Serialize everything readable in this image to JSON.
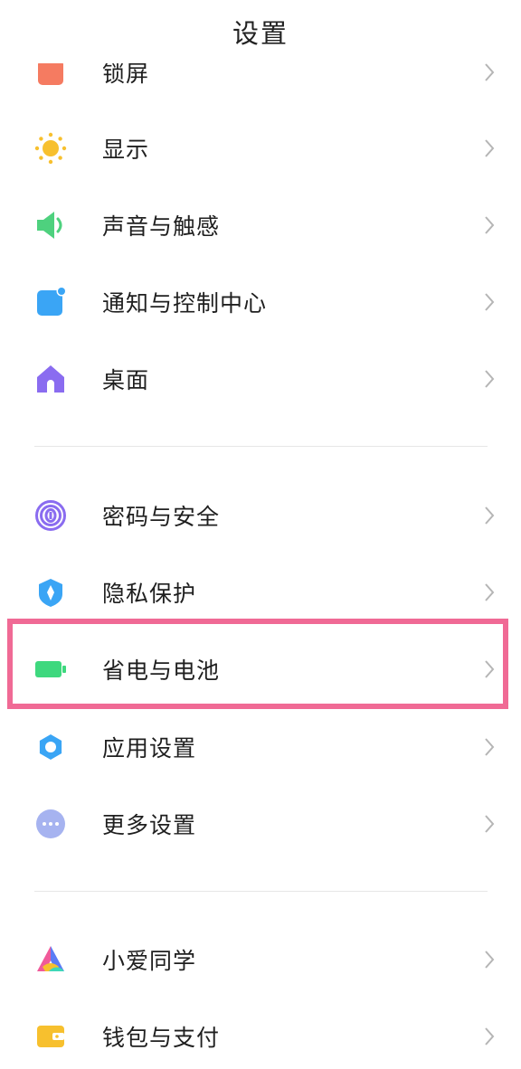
{
  "header": {
    "title": "设置"
  },
  "colors": {
    "highlight": "#f06a95"
  },
  "groups": [
    {
      "items": [
        {
          "label": "锁屏",
          "icon": "lock-screen-icon",
          "color": "#f57b61"
        },
        {
          "label": "显示",
          "icon": "sun-icon",
          "color": "#f7c02e"
        },
        {
          "label": "声音与触感",
          "icon": "speaker-icon",
          "color": "#4ed17e"
        },
        {
          "label": "通知与控制中心",
          "icon": "notification-icon",
          "color": "#3aa5f5"
        },
        {
          "label": "桌面",
          "icon": "home-icon",
          "color": "#8a6cf0"
        }
      ]
    },
    {
      "items": [
        {
          "label": "密码与安全",
          "icon": "fingerprint-icon",
          "color": "#8a6cf0"
        },
        {
          "label": "隐私保护",
          "icon": "privacy-shield-icon",
          "color": "#3aa5f5"
        },
        {
          "label": "省电与电池",
          "icon": "battery-icon",
          "color": "#3ed87e"
        },
        {
          "label": "应用设置",
          "icon": "gear-icon",
          "color": "#3aa5f5"
        },
        {
          "label": "更多设置",
          "icon": "more-icon",
          "color": "#a6b3f0"
        }
      ]
    },
    {
      "items": [
        {
          "label": "小爱同学",
          "icon": "xiaoai-icon",
          "color": "#5b7cf5"
        },
        {
          "label": "钱包与支付",
          "icon": "wallet-icon",
          "color": "#f7c02e"
        }
      ]
    }
  ]
}
